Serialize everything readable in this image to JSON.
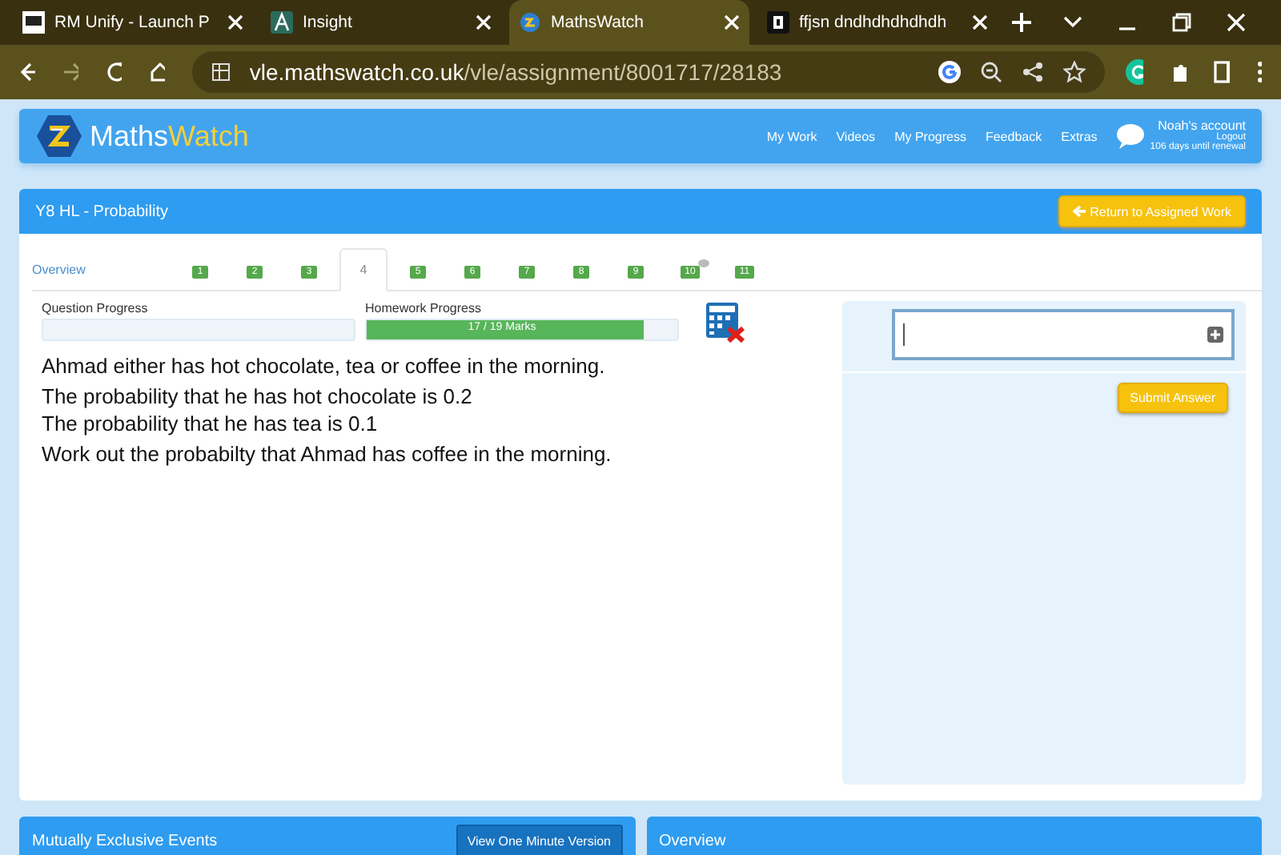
{
  "browser": {
    "tabs": [
      {
        "title": "RM Unify - Launch P",
        "selected": false
      },
      {
        "title": "Insight",
        "selected": false
      },
      {
        "title": "MathsWatch",
        "selected": true
      },
      {
        "title": "ffjsn dndhdhdhdhdh",
        "selected": false
      }
    ],
    "url_host": "vle.mathswatch.co.uk",
    "url_path": "/vle/assignment/8001717/28183"
  },
  "header": {
    "logo_a": "Maths",
    "logo_b": "Watch",
    "nav": [
      "My Work",
      "Videos",
      "My Progress",
      "Feedback",
      "Extras"
    ],
    "account": "Noah's account",
    "logout": "Logout",
    "renewal": "106 days until renewal"
  },
  "assignment": {
    "title": "Y8 HL - Probability",
    "return_button": "Return to Assigned Work",
    "tabs": [
      {
        "label": "Overview",
        "kind": "overview",
        "selected": false,
        "comment": false
      },
      {
        "label": "1",
        "kind": "question",
        "selected": false,
        "comment": false
      },
      {
        "label": "2",
        "kind": "question",
        "selected": false,
        "comment": false
      },
      {
        "label": "3",
        "kind": "question",
        "selected": false,
        "comment": false
      },
      {
        "label": "4",
        "kind": "question",
        "selected": true,
        "comment": false
      },
      {
        "label": "5",
        "kind": "question",
        "selected": false,
        "comment": false
      },
      {
        "label": "6",
        "kind": "question",
        "selected": false,
        "comment": false
      },
      {
        "label": "7",
        "kind": "question",
        "selected": false,
        "comment": false
      },
      {
        "label": "8",
        "kind": "question",
        "selected": false,
        "comment": false
      },
      {
        "label": "9",
        "kind": "question",
        "selected": false,
        "comment": false
      },
      {
        "label": "10",
        "kind": "question",
        "selected": false,
        "comment": true
      },
      {
        "label": "11",
        "kind": "question",
        "selected": false,
        "comment": false
      }
    ],
    "question_progress": {
      "label": "Question Progress"
    },
    "homework_progress": {
      "label": "Homework Progress",
      "level": 0.89,
      "reading": "17 / 19 Marks"
    },
    "question": [
      "Ahmad either has hot chocolate, tea or coffee in the morning.",
      "The probability that he has hot chocolate is 0.2",
      "The probability that he has tea is 0.1",
      "Work out the probabilty that Ahmad has coffee in the morning."
    ],
    "submit_button": "Submit Answer"
  },
  "bottom": {
    "left_title": "Mutually Exclusive Events",
    "video_button": "View One Minute Version",
    "right_title": "Overview"
  }
}
